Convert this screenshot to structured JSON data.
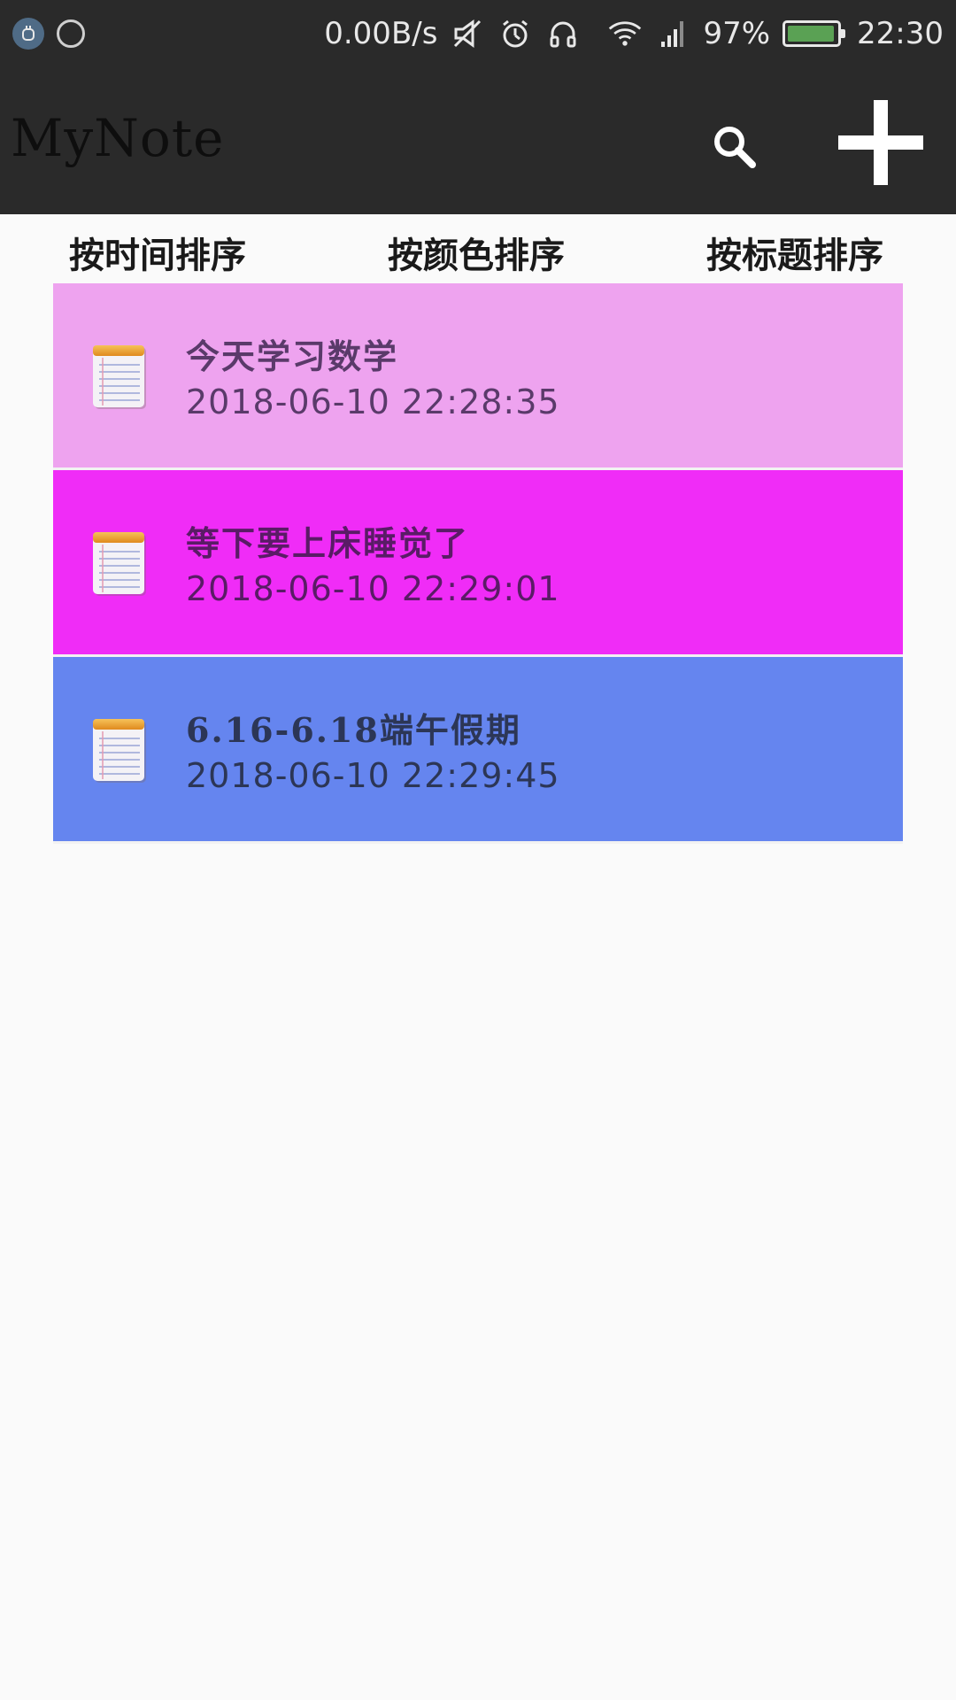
{
  "status_bar": {
    "network_speed": "0.00B/s",
    "battery_percent": "97%",
    "battery_level": 0.97,
    "time": "22:30",
    "icons": [
      "notification-icon",
      "app-icon",
      "mute-icon",
      "alarm-icon",
      "headset-icon",
      "wifi-icon",
      "signal-icon",
      "battery-icon"
    ]
  },
  "app_bar": {
    "title": "MyNote",
    "search_icon": "search-icon",
    "add_icon": "add-icon"
  },
  "sort_bar": {
    "by_time": "按时间排序",
    "by_color": "按颜色排序",
    "by_title": "按标题排序"
  },
  "notes": [
    {
      "title": "今天学习数学",
      "time": "2018-06-10  22:28:35",
      "color": "#eea3ef",
      "text_color": "#5a3a6a"
    },
    {
      "title": "等下要上床睡觉了",
      "time": "2018-06-10  22:29:01",
      "color": "#f02cf7",
      "text_color": "#5a1b66"
    },
    {
      "title": "6.16-6.18端午假期",
      "time": "2018-06-10  22:29:45",
      "color": "#6585ef",
      "text_color": "#2c3656"
    }
  ]
}
